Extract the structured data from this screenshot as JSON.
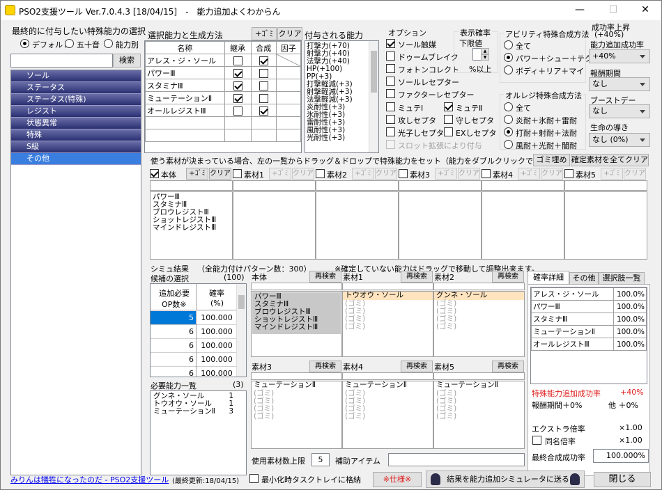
{
  "window": {
    "title": "PSO2支援ツール Ver.7.0.4.3 [18/04/15]　-　能力追加よくわからん",
    "minimize": "—",
    "maximize": "☐",
    "close": "✕"
  },
  "final": {
    "heading": "最終的に付与したい特殊能力の選択",
    "modes": [
      "デフォルト",
      "五十音",
      "能力別"
    ],
    "mode_selected": 0,
    "search_value": "",
    "search_btn": "検索",
    "categories": [
      "ソール",
      "ステータス",
      "ステータス(特殊)",
      "レジスト",
      "状態異常",
      "特殊",
      "S級",
      "その他"
    ],
    "category_active": 7
  },
  "selection": {
    "heading": "選択能力と生成方法",
    "add_trash": "+ｺﾞﾐ",
    "clear": "クリア",
    "columns": [
      "名称",
      "継承",
      "合成",
      "因子"
    ],
    "rows": [
      {
        "name": "アレス・ジ・ソール",
        "inherit": false,
        "compose": true
      },
      {
        "name": "パワーⅢ",
        "inherit": true,
        "compose": false
      },
      {
        "name": "スタミナⅢ",
        "inherit": true,
        "compose": false
      },
      {
        "name": "ミューテーションⅡ",
        "inherit": true,
        "compose": false
      },
      {
        "name": "オールレジストⅢ",
        "inherit": false,
        "compose": true
      }
    ]
  },
  "granted": {
    "heading": "付与される能力",
    "lines": [
      "打撃力(+70)",
      "射撃力(+40)",
      "法撃力(+40)",
      "HP(+100)",
      "PP(+3)",
      "打撃軽減(+3)",
      "射撃軽減(+3)",
      "法撃軽減(+3)",
      "炎耐性(+3)",
      "氷耐性(+3)",
      "雷耐性(+3)",
      "風耐性(+3)",
      "光耐性(+3)"
    ]
  },
  "options": {
    "heading": "オプション",
    "items": [
      {
        "label": "ソール触媒",
        "checked": true,
        "disabled": false
      },
      {
        "label": "ドゥームブレイク",
        "checked": false,
        "disabled": false
      },
      {
        "label": "フォトンコレクト",
        "checked": false,
        "disabled": false
      },
      {
        "label": "ソールレセプター",
        "checked": false,
        "disabled": false
      },
      {
        "label": "ファクターレセプター",
        "checked": false,
        "disabled": false
      },
      {
        "label": "ミュテⅠ",
        "checked": false,
        "disabled": false
      },
      {
        "label": "ミュテⅡ",
        "checked": true,
        "disabled": false
      },
      {
        "label": "攻しセプタ",
        "checked": false,
        "disabled": false
      },
      {
        "label": "守しセプタ",
        "checked": false,
        "disabled": false
      },
      {
        "label": "光子しセプタ",
        "checked": false,
        "disabled": false
      },
      {
        "label": "EXしセプタ",
        "checked": false,
        "disabled": false
      },
      {
        "label": "スロット拡張により付与",
        "checked": false,
        "disabled": true
      }
    ]
  },
  "display_rate": {
    "heading": "表示確率",
    "sub": "下限値",
    "value": "0",
    "suffix": "%以上"
  },
  "ability_method": {
    "heading": "アビリティ特殊合成方法",
    "opts": [
      "全て",
      "パワー＋シュー＋テク",
      "ボディ＋リア＋マイ"
    ],
    "selected": 1
  },
  "resist_method": {
    "heading": "オルレジ特殊合成方法",
    "opts": [
      "全て",
      "炎耐＋氷耐＋雷耐",
      "打耐＋射耐＋法耐",
      "風耐＋光耐＋闇耐"
    ],
    "selected": 2
  },
  "right": {
    "rate_up": "成功率上昇",
    "rate_up_val": "(+40%)",
    "add_rate": "能力追加成功率",
    "add_rate_val": "+40%",
    "period": "報酬期間",
    "period_val": "なし",
    "boost": "ブーストデー",
    "boost_val": "なし",
    "guide": "生命の導き",
    "guide_val": "なし (0%)"
  },
  "materials": {
    "instruction": "使う素材が決まっている場合、左の一覧からドラッグ＆ドロップで特殊能力をセット（能力をダブルクリックで削除）",
    "trash_all": "ゴミ埋め",
    "clear_all": "確定素材を全てクリア",
    "slots": [
      {
        "label": "本体",
        "checked": true,
        "add": "+ｺﾞﾐ",
        "clear": "クリア",
        "items": [
          "パワーⅢ",
          "スタミナⅢ",
          "ブロウレジストⅢ",
          "ショットレジストⅢ",
          "マインドレジストⅢ"
        ]
      },
      {
        "label": "素材1",
        "checked": false,
        "add": "+ｺﾞﾐ",
        "clear": "クリア",
        "items": []
      },
      {
        "label": "素材2",
        "checked": false,
        "add": "+ｺﾞﾐ",
        "clear": "クリア",
        "items": []
      },
      {
        "label": "素材3",
        "checked": false,
        "add": "+ｺﾞﾐ",
        "clear": "クリア",
        "items": []
      },
      {
        "label": "素材4",
        "checked": false,
        "add": "+ｺﾞﾐ",
        "clear": "クリア",
        "items": []
      },
      {
        "label": "素材5",
        "checked": false,
        "add": "+ｺﾞﾐ",
        "clear": "クリア",
        "items": []
      }
    ]
  },
  "sim": {
    "heading": "シミュ結果",
    "patterns": "（全能力付けパターン数：300）",
    "note": "※確定していない能力はドラッグで移動して調整出来ます。",
    "candidates": "候補の選択",
    "candidates_count": "(100)",
    "col1a": "追加必要",
    "col1b": "OP数※",
    "col2a": "確率",
    "col2b": "(%)",
    "rows": [
      [
        "5",
        "100.000"
      ],
      [
        "6",
        "100.000"
      ],
      [
        "6",
        "100.000"
      ],
      [
        "6",
        "100.000"
      ],
      [
        "6",
        "100.000"
      ]
    ],
    "selected_row": 0,
    "needed": "必要能力一覧",
    "needed_count": "(3)",
    "needed_items": [
      [
        "グンネ・ソール",
        "1"
      ],
      [
        "トウオウ・ソール",
        "1"
      ],
      [
        "ミューテーションⅡ",
        "3"
      ]
    ],
    "research": "再検索",
    "slots": [
      {
        "label": "本体",
        "items": [
          "パワーⅢ",
          "スタミナⅢ",
          "ブロウレジストⅢ",
          "ショットレジストⅢ",
          "マインドレジストⅢ"
        ],
        "head": ""
      },
      {
        "label": "素材1",
        "items": [
          "(ゴミ)",
          "(ゴミ)",
          "(ゴミ)",
          "(ゴミ)"
        ],
        "head": "トウオウ・ソール"
      },
      {
        "label": "素材2",
        "items": [
          "(ゴミ)",
          "(ゴミ)",
          "(ゴミ)",
          "(ゴミ)"
        ],
        "head": "グンネ・ソール"
      },
      {
        "label": "素材3",
        "items": [
          "(ゴミ)",
          "(ゴミ)",
          "(ゴミ)",
          "(ゴミ)"
        ],
        "head": "ミューテーションⅡ"
      },
      {
        "label": "素材4",
        "items": [
          "(ゴミ)",
          "(ゴミ)",
          "(ゴミ)",
          "(ゴミ)"
        ],
        "head": "ミューテーションⅡ"
      },
      {
        "label": "素材5",
        "items": [
          "(ゴミ)",
          "(ゴミ)",
          "(ゴミ)",
          "(ゴミ)"
        ],
        "head": "ミューテーションⅡ"
      }
    ],
    "mat_limit": "使用素材数上限",
    "mat_limit_val": "5",
    "aux_item": "補助アイテム"
  },
  "detail": {
    "tabs": [
      "確率詳細",
      "その他",
      "選択肢一覧"
    ],
    "rows": [
      [
        "アレス・ジ・ソール",
        "100.0%"
      ],
      [
        "パワーⅢ",
        "100.0%"
      ],
      [
        "スタミナⅢ",
        "100.0%"
      ],
      [
        "ミューテーションⅡ",
        "100.0%"
      ],
      [
        "オールレジストⅢ",
        "100.0%"
      ]
    ],
    "bonus_label": "特殊能力追加成功率",
    "bonus_val": "+40%",
    "period_label": "報酬期間＋0%",
    "other_label": "他 ＋0%",
    "extra_label": "エクストラ倍率",
    "extra_val": "×1.00",
    "same_label": "同名倍率",
    "same_val": "×1.00",
    "final_label": "最終合成成功率",
    "final_val": "100.000%"
  },
  "footer": {
    "link": "みりんは犠牲になったのだ - PSO2支援ツール",
    "updated": "(最終更新:18/04/15)",
    "tray": "最小化時タスクトレイに格納",
    "spec": "※仕様※",
    "send": "結果を能力追加シミュレータに送る",
    "close": "閉じる"
  },
  "colors": {
    "accent": "#0078d7",
    "red": "#e02020",
    "link": "#0000ee",
    "highlight": "#ffe4bf",
    "greysel": "#c0c0c0"
  }
}
